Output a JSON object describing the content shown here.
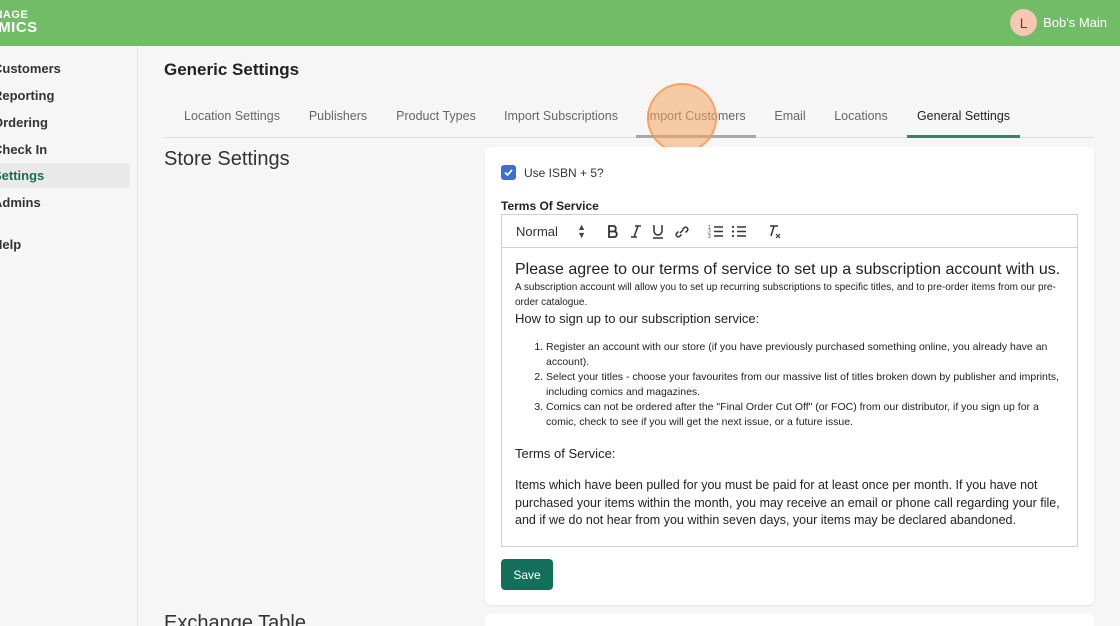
{
  "app": {
    "logo_line1": "ANAGE",
    "logo_line2": "OMICS",
    "user_initial": "L",
    "user_name": "Bob's Main"
  },
  "sidebar": {
    "items": [
      {
        "label": "Customers"
      },
      {
        "label": "Reporting"
      },
      {
        "label": "Ordering"
      },
      {
        "label": "Check In"
      },
      {
        "label": "Settings"
      },
      {
        "label": "Admins"
      },
      {
        "label": "Help"
      }
    ],
    "active": "Settings"
  },
  "header": {
    "title": "Generic Settings"
  },
  "tabs": [
    {
      "label": "Location Settings"
    },
    {
      "label": "Publishers"
    },
    {
      "label": "Product Types"
    },
    {
      "label": "Import Subscriptions"
    },
    {
      "label": "Import Customers"
    },
    {
      "label": "Email"
    },
    {
      "label": "Locations"
    },
    {
      "label": "General Settings"
    }
  ],
  "store_settings": {
    "title": "Store Settings",
    "isbn_checkbox": {
      "label": "Use ISBN + 5?",
      "checked": true
    },
    "tos_label": "Terms Of Service",
    "toolbar": {
      "format_select": "Normal",
      "icons": [
        "bold-icon",
        "italic-icon",
        "underline-icon",
        "link-icon",
        "ordered-list-icon",
        "bullet-list-icon",
        "clear-format-icon"
      ]
    },
    "content": {
      "heading": "Please agree to our terms of service to set up a subscription account with us.",
      "intro": "A subscription account will allow you to set up recurring subscriptions to specific titles, and to pre-order items from our pre-order catalogue.",
      "how_to": "How to sign up to our subscription service:",
      "steps": [
        "Register an account with our store (if you have previously purchased something online, you already have an account).",
        "Select your titles - choose your favourites from our massive list of titles broken down by publisher and imprints, including comics and magazines.",
        "Comics can not be ordered after the \"Final Order Cut Off\" (or FOC) from our distributor, if you sign up for a comic, check to see if you will get the next issue, or a future issue."
      ],
      "tos_heading": "Terms of Service:",
      "tos_text": "Items which have been pulled for you must be paid for at least once per month. If you have not purchased your items within the month, you may receive an email or phone call regarding your file, and if we do not hear from you within seven days, your items may be declared abandoned."
    },
    "save_label": "Save"
  },
  "exchange_table": {
    "title": "Exchange Table"
  },
  "colors": {
    "topbar": "#72bb67",
    "primary": "#12705a",
    "active_tab_underline": "#2a8a6a",
    "checkbox": "#3b6fd4",
    "avatar": "#f6c8b4"
  }
}
